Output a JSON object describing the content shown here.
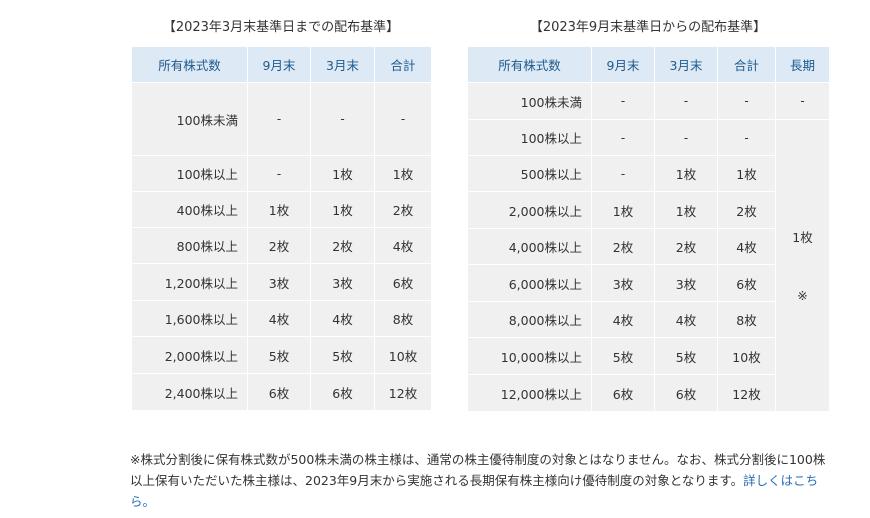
{
  "left": {
    "title": "【2023年3月末基準日までの配布基準】",
    "headers": [
      "所有株式数",
      "9月末",
      "3月末",
      "合計"
    ],
    "rows": [
      [
        "100株未満",
        "-",
        "-",
        "-"
      ],
      [
        "100株以上",
        "-",
        "1枚",
        "1枚"
      ],
      [
        "400株以上",
        "1枚",
        "1枚",
        "2枚"
      ],
      [
        "800株以上",
        "2枚",
        "2枚",
        "4枚"
      ],
      [
        "1,200株以上",
        "3枚",
        "3枚",
        "6枚"
      ],
      [
        "1,600株以上",
        "4枚",
        "4枚",
        "8枚"
      ],
      [
        "2,000株以上",
        "5枚",
        "5枚",
        "10枚"
      ],
      [
        "2,400株以上",
        "6枚",
        "6枚",
        "12枚"
      ]
    ]
  },
  "right": {
    "title": "【2023年9月末基準日からの配布基準】",
    "headers": [
      "所有株式数",
      "9月末",
      "3月末",
      "合計",
      "長期"
    ],
    "rows": [
      [
        "100株未満",
        "-",
        "-",
        "-"
      ],
      [
        "100株以上",
        "-",
        "-",
        "-"
      ],
      [
        "500株以上",
        "-",
        "1枚",
        "1枚"
      ],
      [
        "2,000株以上",
        "1枚",
        "1枚",
        "2枚"
      ],
      [
        "4,000株以上",
        "2枚",
        "2枚",
        "4枚"
      ],
      [
        "6,000株以上",
        "3枚",
        "3枚",
        "6枚"
      ],
      [
        "8,000株以上",
        "4枚",
        "4枚",
        "8枚"
      ],
      [
        "10,000株以上",
        "5枚",
        "5枚",
        "10枚"
      ],
      [
        "12,000株以上",
        "6枚",
        "6枚",
        "12枚"
      ]
    ],
    "long_term_first": "-",
    "long_term_value": "1枚",
    "long_term_mark": "※"
  },
  "notes": {
    "text": "※株式分割後に保有株式数が500株未満の株主様は、通常の株主優待制度の対象とはなりません。なお、株式分割後に100株以上保有いただいた株主様は、2023年9月末から実施される長期保有株主様向け優待制度の対象となります。",
    "link": "詳しくはこちら。"
  }
}
